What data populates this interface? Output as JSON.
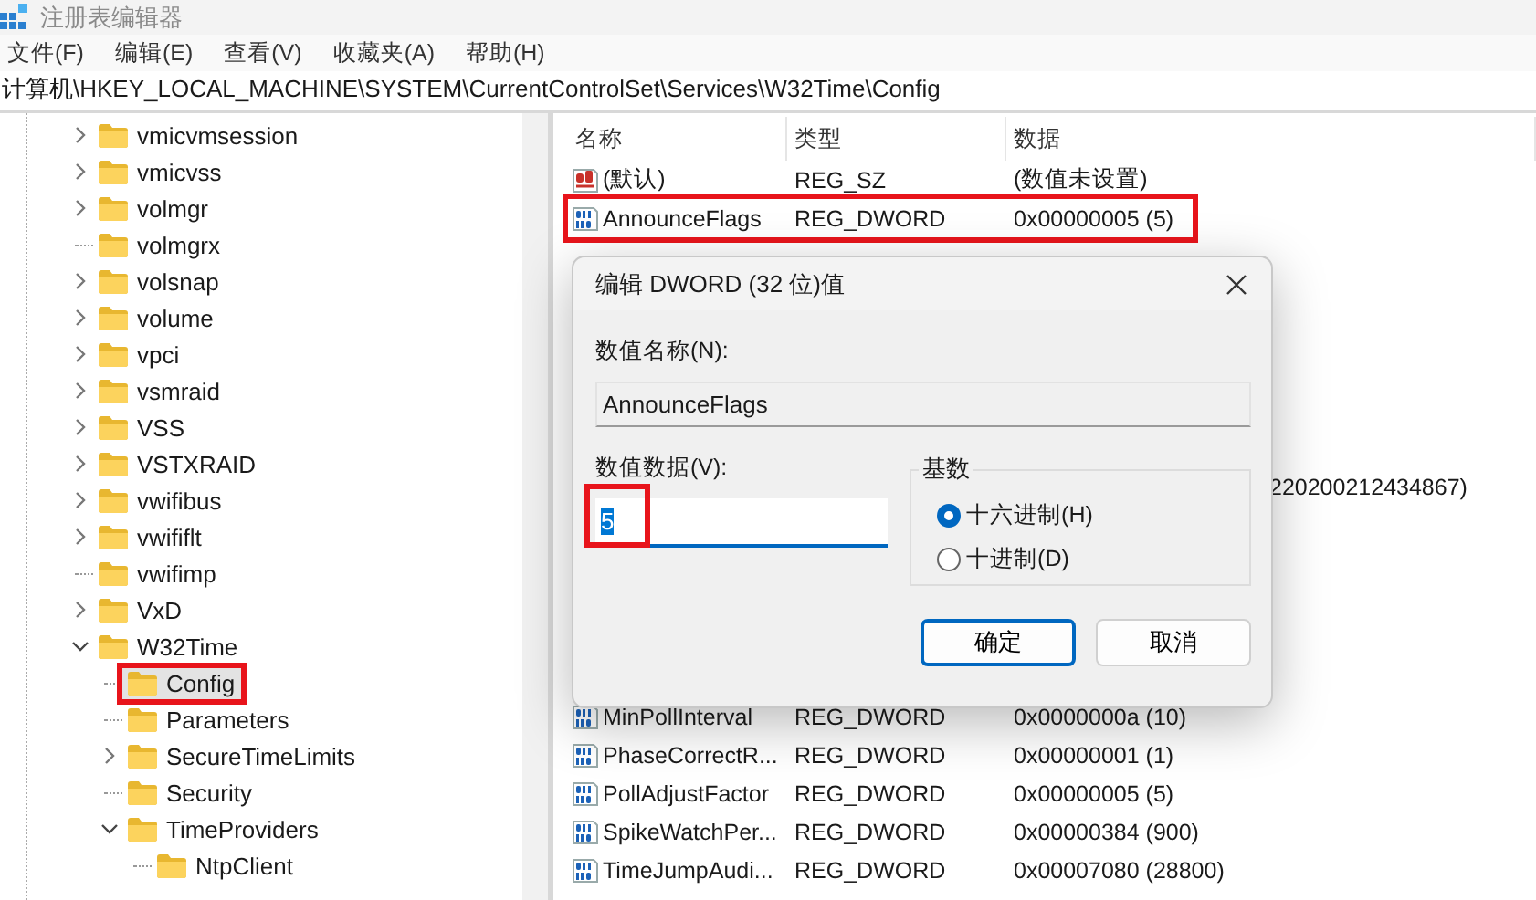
{
  "window": {
    "title": "注册表编辑器"
  },
  "menu": [
    "文件(F)",
    "编辑(E)",
    "查看(V)",
    "收藏夹(A)",
    "帮助(H)"
  ],
  "address": "计算机\\HKEY_LOCAL_MACHINE\\SYSTEM\\CurrentControlSet\\Services\\W32Time\\Config",
  "tree": {
    "items": [
      {
        "label": "vmicvmsession",
        "kind": "collapsed",
        "selected": false,
        "highlighted": false
      },
      {
        "label": "vmicvss",
        "kind": "collapsed",
        "selected": false,
        "highlighted": false
      },
      {
        "label": "volmgr",
        "kind": "collapsed",
        "selected": false,
        "highlighted": false
      },
      {
        "label": "volmgrx",
        "kind": "leaf",
        "selected": false,
        "highlighted": false
      },
      {
        "label": "volsnap",
        "kind": "collapsed",
        "selected": false,
        "highlighted": false
      },
      {
        "label": "volume",
        "kind": "collapsed",
        "selected": false,
        "highlighted": false
      },
      {
        "label": "vpci",
        "kind": "collapsed",
        "selected": false,
        "highlighted": false
      },
      {
        "label": "vsmraid",
        "kind": "collapsed",
        "selected": false,
        "highlighted": false
      },
      {
        "label": "VSS",
        "kind": "collapsed",
        "selected": false,
        "highlighted": false
      },
      {
        "label": "VSTXRAID",
        "kind": "collapsed",
        "selected": false,
        "highlighted": false
      },
      {
        "label": "vwifibus",
        "kind": "collapsed",
        "selected": false,
        "highlighted": false
      },
      {
        "label": "vwififlt",
        "kind": "collapsed",
        "selected": false,
        "highlighted": false
      },
      {
        "label": "vwifimp",
        "kind": "leaf",
        "selected": false,
        "highlighted": false
      },
      {
        "label": "VxD",
        "kind": "collapsed",
        "selected": false,
        "highlighted": false
      },
      {
        "label": "W32Time",
        "kind": "expanded",
        "selected": false,
        "highlighted": false,
        "children": [
          {
            "label": "Config",
            "kind": "leaf",
            "selected": true,
            "highlighted": true
          },
          {
            "label": "Parameters",
            "kind": "leaf",
            "selected": false,
            "highlighted": false
          },
          {
            "label": "SecureTimeLimits",
            "kind": "collapsed",
            "selected": false,
            "highlighted": false
          },
          {
            "label": "Security",
            "kind": "leaf",
            "selected": false,
            "highlighted": false
          },
          {
            "label": "TimeProviders",
            "kind": "expanded",
            "selected": false,
            "highlighted": false,
            "children": [
              {
                "label": "NtpClient",
                "kind": "leaf",
                "selected": false,
                "highlighted": false
              }
            ]
          }
        ]
      }
    ]
  },
  "values": {
    "columns": [
      "名称",
      "类型",
      "数据"
    ],
    "rows": [
      {
        "kind": "string",
        "name": "(默认)",
        "type": "REG_SZ",
        "data": "(数值未设置)",
        "highlighted": false
      },
      {
        "kind": "dword",
        "name": "AnnounceFlags",
        "type": "REG_DWORD",
        "data": "0x00000005 (5)",
        "highlighted": true
      },
      {
        "kind": "covered"
      },
      {
        "kind": "covered"
      },
      {
        "kind": "covered"
      },
      {
        "kind": "covered"
      },
      {
        "kind": "covered"
      },
      {
        "kind": "covered"
      },
      {
        "kind": "tail",
        "data": "220200212434867)"
      },
      {
        "kind": "covered"
      },
      {
        "kind": "covered"
      },
      {
        "kind": "covered"
      },
      {
        "kind": "covered"
      },
      {
        "kind": "covered"
      },
      {
        "kind": "dword",
        "name": "MinPollInterval",
        "type": "REG_DWORD",
        "data": "0x0000000a (10)",
        "highlighted": false
      },
      {
        "kind": "dword",
        "name": "PhaseCorrectR...",
        "type": "REG_DWORD",
        "data": "0x00000001 (1)",
        "highlighted": false
      },
      {
        "kind": "dword",
        "name": "PollAdjustFactor",
        "type": "REG_DWORD",
        "data": "0x00000005 (5)",
        "highlighted": false
      },
      {
        "kind": "dword",
        "name": "SpikeWatchPer...",
        "type": "REG_DWORD",
        "data": "0x00000384 (900)",
        "highlighted": false
      },
      {
        "kind": "dword",
        "name": "TimeJumpAudi...",
        "type": "REG_DWORD",
        "data": "0x00007080 (28800)",
        "highlighted": false
      }
    ]
  },
  "dialog": {
    "title": "编辑 DWORD (32 位)值",
    "name_label": "数值名称(N):",
    "name_value": "AnnounceFlags",
    "data_label": "数值数据(V):",
    "data_value": "5",
    "data_highlighted": true,
    "base": {
      "label": "基数",
      "options": [
        {
          "label": "十六进制(H)",
          "selected": true
        },
        {
          "label": "十进制(D)",
          "selected": false
        }
      ]
    },
    "buttons": [
      {
        "label": "确定",
        "default": true
      },
      {
        "label": "取消",
        "default": false
      }
    ]
  }
}
